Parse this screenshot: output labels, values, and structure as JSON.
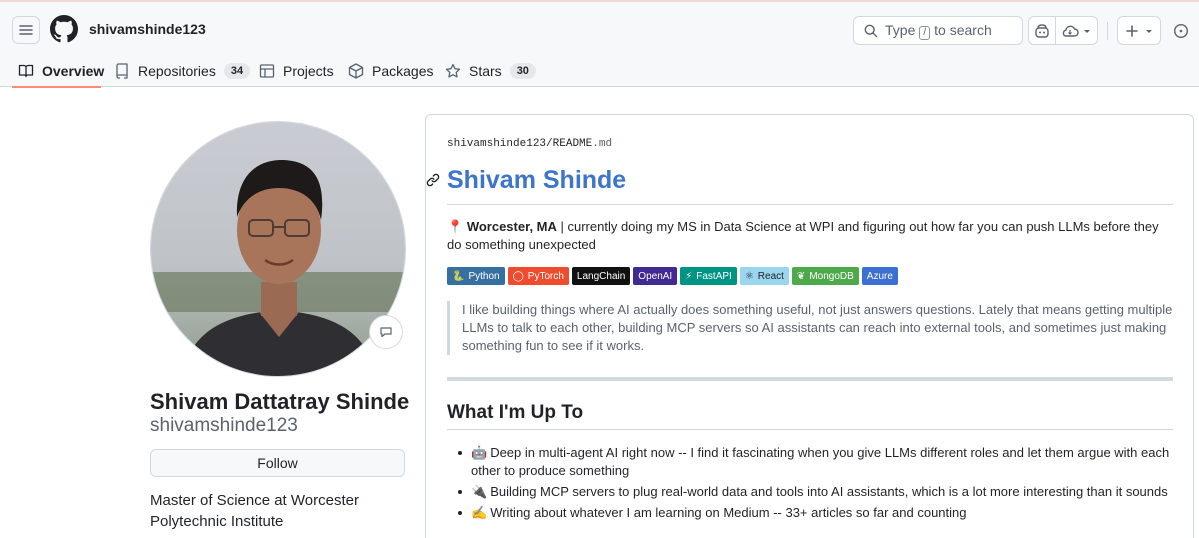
{
  "header": {
    "username": "shivamshinde123",
    "search": {
      "prefix": "Type",
      "key": "/",
      "suffix": "to search"
    }
  },
  "tabs": [
    {
      "label": "Overview",
      "icon": "book-icon"
    },
    {
      "label": "Repositories",
      "icon": "repo-icon",
      "count": "34"
    },
    {
      "label": "Projects",
      "icon": "table-icon"
    },
    {
      "label": "Packages",
      "icon": "package-icon"
    },
    {
      "label": "Stars",
      "icon": "star-icon",
      "count": "30"
    }
  ],
  "profile": {
    "full_name": "Shivam Dattatray Shinde",
    "login": "shivamshinde123",
    "follow_label": "Follow",
    "bio": "Master of Science at Worcester Polytechnic Institute",
    "status_icon": "speech-bubble-icon"
  },
  "readme": {
    "path_owner": "shivamshinde123",
    "path_sep": "/",
    "path_file": "README",
    "path_ext": ".md",
    "title": "Shivam Shinde",
    "intro_pin": "📍",
    "intro_location": "Worcester, MA",
    "intro_rest": " | currently doing my MS in Data Science at WPI and figuring out how far you can push LLMs before they do something unexpected",
    "badges": [
      {
        "label": "Python",
        "icon": "🐍",
        "color": "#3670a0"
      },
      {
        "label": "PyTorch",
        "icon": "◯",
        "color": "#ee4c2c"
      },
      {
        "label": "LangChain",
        "icon": "",
        "color": "#1c3c3c"
      },
      {
        "label": "OpenAI",
        "icon": "",
        "color": "#412991"
      },
      {
        "label": "FastAPI",
        "icon": "⚡",
        "color": "#009485"
      },
      {
        "label": "React",
        "icon": "⚛",
        "color": "#20232a",
        "text_color": "#61dafb"
      },
      {
        "label": "MongoDB",
        "icon": "❦",
        "color": "#4ea94b"
      },
      {
        "label": "Azure",
        "icon": "",
        "color": "#0089d6"
      }
    ],
    "quote": "I like building things where AI actually does something useful, not just answers questions. Lately that means getting multiple LLMs to talk to each other, building MCP servers so AI assistants can reach into external tools, and sometimes just making something fun to see if it works.",
    "section_title": "What I'm Up To",
    "items": [
      {
        "emoji": "🤖",
        "text": "Deep in multi-agent AI right now -- I find it fascinating when you give LLMs different roles and let them argue with each other to produce something"
      },
      {
        "emoji": "🔌",
        "text": "Building MCP servers to plug real-world data and tools into AI assistants, which is a lot more interesting than it sounds"
      },
      {
        "emoji": "✍️",
        "text": "Writing about whatever I am learning on Medium -- 33+ articles so far and counting"
      }
    ]
  }
}
